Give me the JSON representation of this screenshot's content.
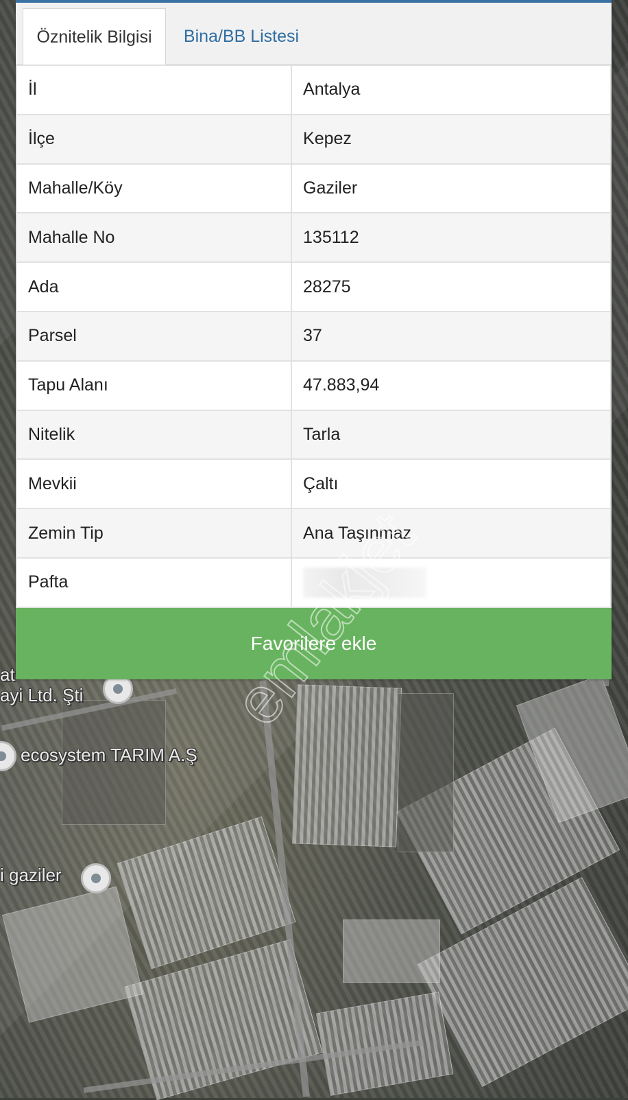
{
  "tabs": [
    {
      "label": "Öznitelik Bilgisi"
    },
    {
      "label": "Bina/BB Listesi"
    }
  ],
  "attributes": [
    {
      "key": "İl",
      "value": "Antalya"
    },
    {
      "key": "İlçe",
      "value": "Kepez"
    },
    {
      "key": "Mahalle/Köy",
      "value": "Gaziler"
    },
    {
      "key": "Mahalle No",
      "value": "135112"
    },
    {
      "key": "Ada",
      "value": "28275"
    },
    {
      "key": "Parsel",
      "value": "37"
    },
    {
      "key": "Tapu Alanı",
      "value": "47.883,94"
    },
    {
      "key": "Nitelik",
      "value": "Tarla"
    },
    {
      "key": "Mevkii",
      "value": "Çaltı"
    },
    {
      "key": "Zemin Tip",
      "value": "Ana Taşınmaz"
    },
    {
      "key": "Pafta",
      "value": ""
    }
  ],
  "favorite_button": {
    "label": "Favorilere ekle"
  },
  "map": {
    "labels": {
      "company_1": "ayi Ltd. Şti",
      "company_1_top": "at",
      "company_2": "ecosystem TARIM A.Ş",
      "place": "i gaziler"
    }
  },
  "colors": {
    "tab_accent": "#2f6ea3",
    "button_green": "#68b35f",
    "top_line": "#3b72a6"
  }
}
